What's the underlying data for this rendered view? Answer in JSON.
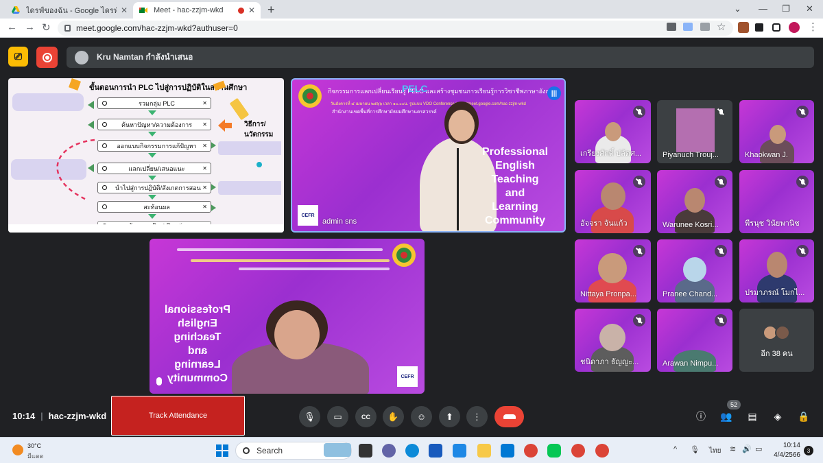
{
  "browser": {
    "tabs": [
      {
        "title": "ไดรฟ์ของฉัน - Google ไดรฟ์",
        "active": false
      },
      {
        "title": "Meet - hac-zzjm-wkd",
        "active": true
      }
    ],
    "new_tab_label": "+",
    "url": "meet.google.com/hac-zzjm-wkd?authuser=0"
  },
  "meet": {
    "presenter_banner": "Kru Namtan กำลังนำเสนอ",
    "slide": {
      "title": "ขั้นตอนการนำ PLC ไปสู่การปฏิบัติในสถานศึกษา",
      "steps": [
        "รวมกลุ่ม PLC",
        "ค้นหาปัญหา/ความต้องการ",
        "ออกแบบกิจกรรมการแก้ปัญหา",
        "แลกเปลี่ยน/เสนอแนะ",
        "นำไปสู่การปฏิบัติ/สังเกตการสอน",
        "สะท้อนผล",
        "นวัตกรรม Best Practice"
      ],
      "side_label": "วิธีการ/นวัตกรรม"
    },
    "main_tile": {
      "banner_title": "กิจกรรมการแลกเปลี่ยนเรียนรู้ PELC และสร้างชุมชนการเรียนรู้การวิชาชีพภาษาอังกฤษ",
      "banner_pelc": "PELC",
      "banner_date": "วันอังคารที่ ๔ เมษายน ๒๕๖๖ เวลา ๑๐.๐๐น. รูปแบบ VDO Conference https://meet.google.com/hac-zzjm-wkd",
      "banner_org": "สำนักงานเขตพื้นที่การศึกษามัธยมศึกษานครสวรรค์",
      "text_lines": [
        "Professional",
        "English",
        "Teaching",
        "and",
        "Learning",
        "Community"
      ],
      "name": "admin sns",
      "cefr": "CEFR"
    },
    "self_tile": {
      "text_lines": [
        "Professional",
        "English",
        "Teaching",
        "and",
        "Learning",
        "Community"
      ],
      "cefr": "CEFR"
    },
    "participants": [
      {
        "name": "เกรียงศักดิ์ ปลัดศ..."
      },
      {
        "name": "Piyanuch Trouj..."
      },
      {
        "name": "Khaokwan J."
      },
      {
        "name": "อัจจรา จันแก้ว"
      },
      {
        "name": "Warunee Kosri..."
      },
      {
        "name": "พีรนุช วินัยพานิช"
      },
      {
        "name": "Nittaya Pronpa..."
      },
      {
        "name": "Pranee Chand..."
      },
      {
        "name": "ปรมาภรณ์ โมกไ..."
      },
      {
        "name": "ชนิดาภา ธัญญะ..."
      },
      {
        "name": "Arawan Nimpu..."
      }
    ],
    "more_label": "อีก 38 คน",
    "bottom": {
      "time": "10:14",
      "meeting_code": "hac-zzjm-wkd",
      "track_label": "Track Attendance",
      "participant_count": "52"
    }
  },
  "taskbar": {
    "weather_temp": "30°C",
    "weather_desc": "มีแดด",
    "search_label": "Search",
    "lang": "ไทย",
    "clock_time": "10:14",
    "clock_date": "4/4/2566",
    "notif_count": "3"
  },
  "colors": {
    "meet_bg": "#202124",
    "tile_purple": "#b13ad8",
    "end_call": "#ea4335",
    "track_button": "#c5221f"
  }
}
